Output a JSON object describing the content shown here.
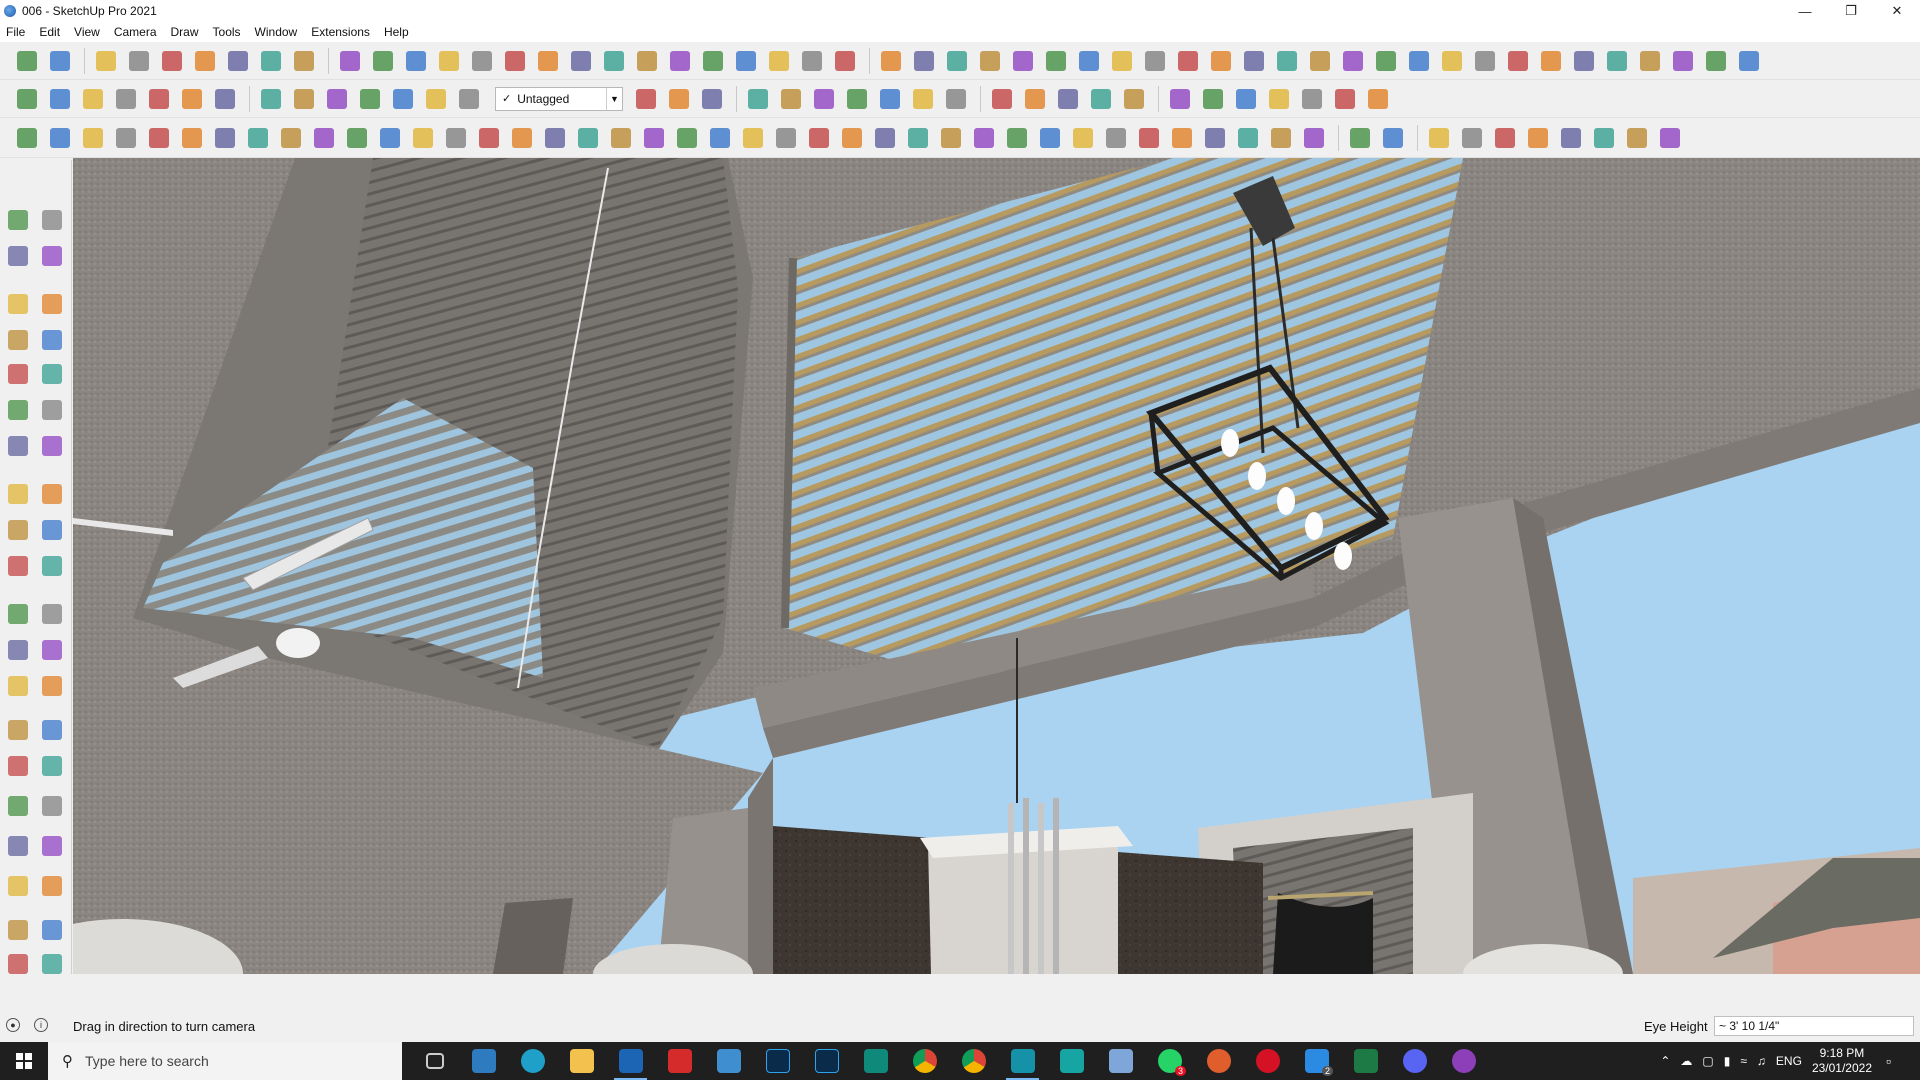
{
  "window": {
    "title": "006 - SketchUp Pro 2021"
  },
  "menu": [
    "File",
    "Edit",
    "View",
    "Camera",
    "Draw",
    "Tools",
    "Window",
    "Extensions",
    "Help"
  ],
  "toolbar": {
    "tag_value": "Untagged",
    "tag_check": "✓"
  },
  "status": {
    "hint": "Drag in direction to turn camera",
    "measure_label": "Eye Height",
    "measure_value": "~ 3' 10 1/4\""
  },
  "taskbar": {
    "search_placeholder": "Type here to search",
    "language": "ENG",
    "time": "9:18 PM",
    "date": "23/01/2022",
    "whatsapp_badge": "3",
    "vscode_badge": "2"
  },
  "colors": {
    "accent": "#79b8f3",
    "sky": "#a9d3f1",
    "concrete": "#8a8580"
  },
  "icons": [
    "sketchup-icon",
    "windows-start-icon",
    "search-icon",
    "edge-icon",
    "file-explorer-icon",
    "sketchup-taskbar-icon",
    "acrobat-icon",
    "photoshop-icon",
    "chrome-icon",
    "whatsapp-icon",
    "excel-icon",
    "discord-icon",
    "vscode-icon"
  ]
}
